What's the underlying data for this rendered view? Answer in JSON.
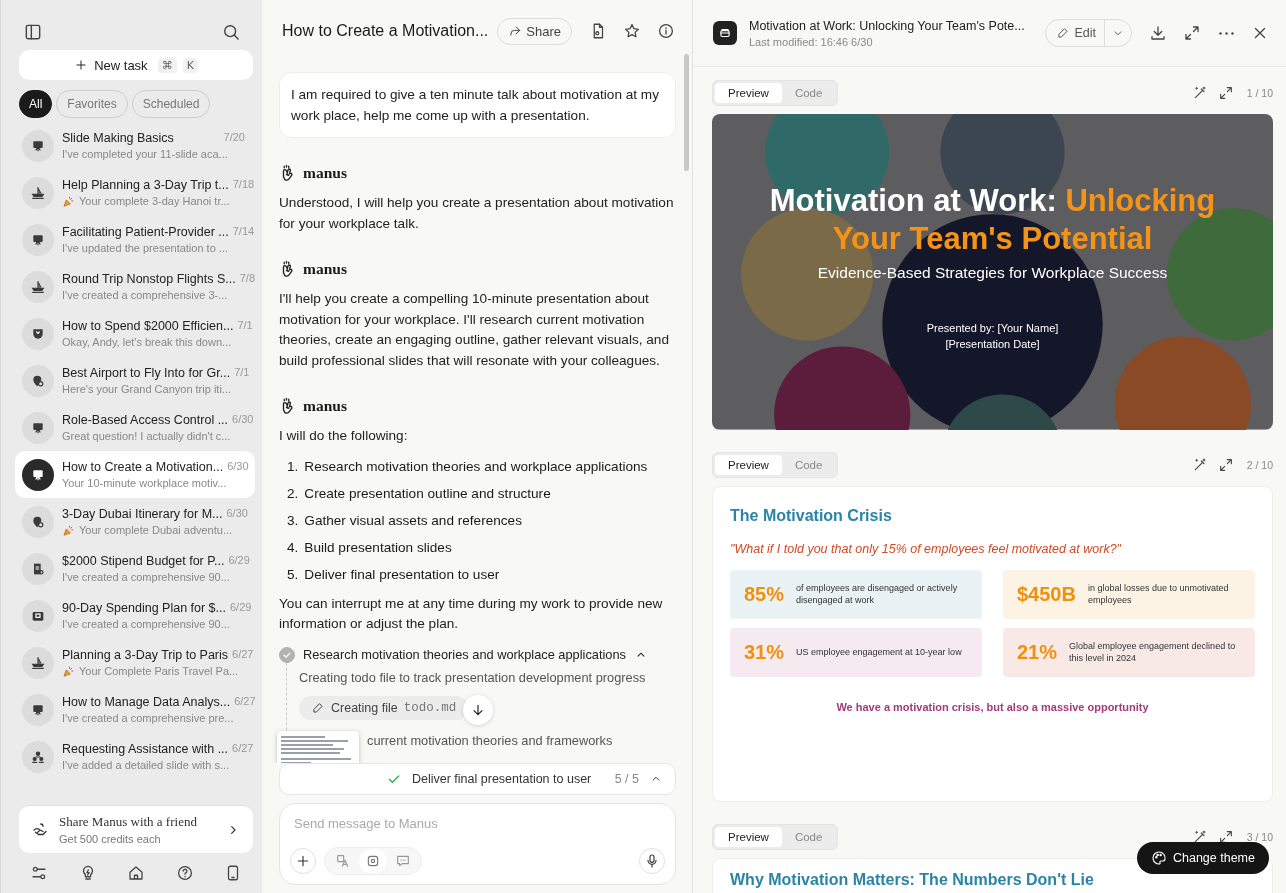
{
  "sidebar": {
    "new_task": {
      "label": "New task",
      "shortcut": [
        "⌘",
        "K"
      ]
    },
    "filters": [
      {
        "label": "All",
        "selected": true
      },
      {
        "label": "Favorites",
        "selected": false
      },
      {
        "label": "Scheduled",
        "selected": false
      }
    ],
    "tasks": [
      {
        "kind": "presentation",
        "title": "Slide Making Basics",
        "date": "7/20",
        "preview": "I've completed your 11-slide aca...",
        "party": false,
        "selected": false
      },
      {
        "kind": "boat",
        "title": "Help Planning a 3-Day Trip t...",
        "date": "7/18",
        "preview": "Your complete 3-day Hanoi tr...",
        "party": true,
        "selected": false
      },
      {
        "kind": "presentation",
        "title": "Facilitating Patient-Provider ...",
        "date": "7/14",
        "preview": "I've updated the presentation to ...",
        "party": false,
        "selected": false
      },
      {
        "kind": "boat",
        "title": "Round Trip Nonstop Flights S...",
        "date": "7/8",
        "preview": "I've created a comprehensive 3-...",
        "party": false,
        "selected": false
      },
      {
        "kind": "shield",
        "title": "How to Spend $2000 Efficien...",
        "date": "7/1",
        "preview": "Okay, Andy, let's break this down...",
        "party": false,
        "selected": false
      },
      {
        "kind": "pin",
        "title": "Best Airport to Fly Into for Gr...",
        "date": "7/1",
        "preview": "Here's your Grand Canyon trip iti...",
        "party": false,
        "selected": false
      },
      {
        "kind": "presentation",
        "title": "Role-Based Access Control ...",
        "date": "6/30",
        "preview": "Great question! I actually didn't c...",
        "party": false,
        "selected": false
      },
      {
        "kind": "presentation",
        "title": "How to Create a Motivation...",
        "date": "6/30",
        "preview": "Your 10-minute workplace motiv...",
        "party": false,
        "selected": true
      },
      {
        "kind": "pin",
        "title": "3-Day Dubai Itinerary for M...",
        "date": "6/30",
        "preview": "Your complete Dubai adventu...",
        "party": true,
        "selected": false
      },
      {
        "kind": "receipt",
        "title": "$2000 Stipend Budget for P...",
        "date": "6/29",
        "preview": "I've created a comprehensive 90...",
        "party": false,
        "selected": false
      },
      {
        "kind": "safe",
        "title": "90-Day Spending Plan for $...",
        "date": "6/29",
        "preview": "I've created a comprehensive 90...",
        "party": false,
        "selected": false
      },
      {
        "kind": "boat",
        "title": "Planning a 3-Day Trip to Paris",
        "date": "6/27",
        "preview": "Your Complete Paris Travel Pa...",
        "party": true,
        "selected": false
      },
      {
        "kind": "presentation",
        "title": "How to Manage Data Analys...",
        "date": "6/27",
        "preview": "I've created a comprehensive pre...",
        "party": false,
        "selected": false
      },
      {
        "kind": "team",
        "title": "Requesting Assistance with ...",
        "date": "6/27",
        "preview": "I've added a detailed slide with s...",
        "party": false,
        "selected": false
      }
    ],
    "share": {
      "title": "Share Manus with a friend",
      "subtitle": "Get 500 credits each"
    }
  },
  "chat": {
    "title": "How to Create a Motivation...",
    "share": "Share",
    "user_message": "I am required to give a ten minute talk about motivation at my work place, help me come up with a presentation.",
    "replies": [
      {
        "author": "manus",
        "blocks": [
          {
            "kind": "paragraph",
            "text": "Understood, I will help you create a presentation about motivation for your workplace talk."
          }
        ]
      },
      {
        "author": "manus",
        "blocks": [
          {
            "kind": "paragraph",
            "text": "I'll help you create a compelling 10-minute presentation about motivation for your workplace. I'll research current motivation theories, create an engaging outline, gather relevant visuals, and build professional slides that will resonate with your colleagues."
          }
        ]
      },
      {
        "author": "manus",
        "blocks": [
          {
            "kind": "paragraph",
            "text": "I will do the following:"
          },
          {
            "kind": "list",
            "items": [
              {
                "number": "1.",
                "text": "Research motivation theories and workplace applications"
              },
              {
                "number": "2.",
                "text": "Create presentation outline and structure"
              },
              {
                "number": "3.",
                "text": "Gather visual assets and references"
              },
              {
                "number": "4.",
                "text": "Build presentation slides"
              },
              {
                "number": "5.",
                "text": "Deliver final presentation to user"
              }
            ]
          },
          {
            "kind": "paragraph",
            "text": "You can interrupt me at any time during my work to provide new information or adjust the plan."
          }
        ]
      }
    ],
    "step": {
      "title": "Research motivation theories and workplace applications",
      "done": true,
      "expanded": true,
      "substeps": [
        {
          "kind": "text",
          "text": "Creating todo file to track presentation development progress"
        },
        {
          "kind": "file",
          "action": "Creating file",
          "file": "todo.md"
        },
        {
          "kind": "text",
          "text": "current motivation theories and frameworks"
        }
      ]
    },
    "progress": {
      "label": "Deliver final presentation to user",
      "done": true,
      "count": "5 / 5"
    },
    "composer": {
      "placeholder": "Send message to Manus"
    }
  },
  "viewer": {
    "title": "Motivation at Work: Unlocking Your Team's Pote...",
    "modified": "Last modified: 16:46 6/30",
    "edit": "Edit",
    "slides": [
      {
        "kind": "title",
        "tabs": [
          {
            "label": "Preview",
            "selected": true
          },
          {
            "label": "Code",
            "selected": false
          }
        ],
        "counter": "1 / 10",
        "title": "Motivation at Work: ",
        "highlight": "Unlocking Your Team's Potential",
        "subtitle": "Evidence-Based Strategies for Workplace Success",
        "presenter": "Presented by: [Your Name]",
        "date": "[Presentation Date]"
      },
      {
        "kind": "stats",
        "tabs": [
          {
            "label": "Preview",
            "selected": true
          },
          {
            "label": "Code",
            "selected": false
          }
        ],
        "counter": "2 / 10",
        "title": "The Motivation Crisis",
        "quote": "\"What if I told you that only 15% of employees feel motivated at work?\"",
        "stats": [
          {
            "value": "85%",
            "text": "of employees are disengaged or actively disengaged at work",
            "color": "#e9f2f5"
          },
          {
            "value": "$450B",
            "text": "in global losses due to unmotivated employees",
            "color": "#fdf3e4"
          },
          {
            "value": "31%",
            "text": "US employee engagement at 10-year low",
            "color": "#f5eaf0"
          },
          {
            "value": "21%",
            "text": "Global employee engagement declined to this level in 2024",
            "color": "#f9e9e6"
          }
        ],
        "footer": "We have a motivation crisis, but also a massive opportunity"
      },
      {
        "kind": "heading",
        "tabs": [
          {
            "label": "Preview",
            "selected": true
          },
          {
            "label": "Code",
            "selected": false
          }
        ],
        "counter": "3 / 10",
        "title": "Why Motivation Matters: The Numbers Don't Lie"
      }
    ],
    "theme_button": "Change theme"
  }
}
